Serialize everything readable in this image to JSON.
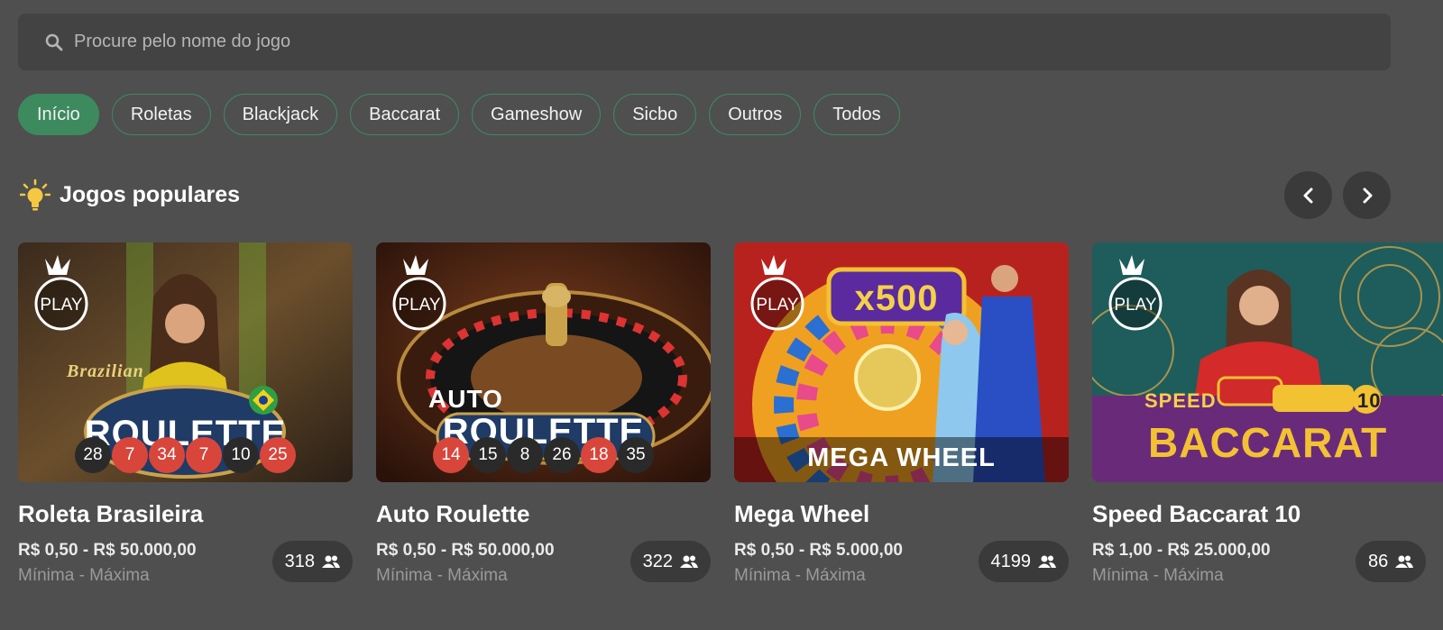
{
  "search": {
    "placeholder": "Procure pelo nome do jogo",
    "icon": "search-icon"
  },
  "tabs": [
    {
      "label": "Início",
      "active": true
    },
    {
      "label": "Roletas"
    },
    {
      "label": "Blackjack"
    },
    {
      "label": "Baccarat"
    },
    {
      "label": "Gameshow"
    },
    {
      "label": "Sicbo"
    },
    {
      "label": "Outros"
    },
    {
      "label": "Todos"
    }
  ],
  "section": {
    "title": "Jogos populares",
    "icon": "lightbulb-icon"
  },
  "colors": {
    "accent": "#3d8a5f",
    "red_ball": "#d8463b",
    "background": "#4f4f4f"
  },
  "brand_badge": "PLAY",
  "cards": [
    {
      "name": "Roleta Brasileira",
      "thumb_title": "ROULETTE",
      "thumb_subtitle": "Brazilian",
      "results": [
        {
          "n": "28",
          "color": "black"
        },
        {
          "n": "7",
          "color": "red"
        },
        {
          "n": "34",
          "color": "red"
        },
        {
          "n": "7",
          "color": "red"
        },
        {
          "n": "10",
          "color": "black"
        },
        {
          "n": "25",
          "color": "red"
        }
      ],
      "range": "R$ 0,50 - R$ 50.000,00",
      "range_label": "Mínima - Máxima",
      "players": "318"
    },
    {
      "name": "Auto Roulette",
      "thumb_title": "ROULETTE",
      "thumb_subtitle": "AUTO",
      "results": [
        {
          "n": "14",
          "color": "red"
        },
        {
          "n": "15",
          "color": "black"
        },
        {
          "n": "8",
          "color": "black"
        },
        {
          "n": "26",
          "color": "black"
        },
        {
          "n": "18",
          "color": "red"
        },
        {
          "n": "35",
          "color": "black"
        }
      ],
      "range": "R$ 0,50 - R$ 50.000,00",
      "range_label": "Mínima - Máxima",
      "players": "322"
    },
    {
      "name": "Mega Wheel",
      "thumb_title": "MEGA WHEEL",
      "thumb_subtitle": "x500",
      "range": "R$ 0,50 - R$ 5.000,00",
      "range_label": "Mínima - Máxima",
      "players": "4199"
    },
    {
      "name": "Speed Baccarat 10",
      "thumb_title": "BACCARAT",
      "thumb_subtitle": "SPEED",
      "thumb_badge": "10",
      "range": "R$ 1,00 - R$ 25.000,00",
      "range_label": "Mínima - Máxima",
      "players": "86"
    }
  ]
}
